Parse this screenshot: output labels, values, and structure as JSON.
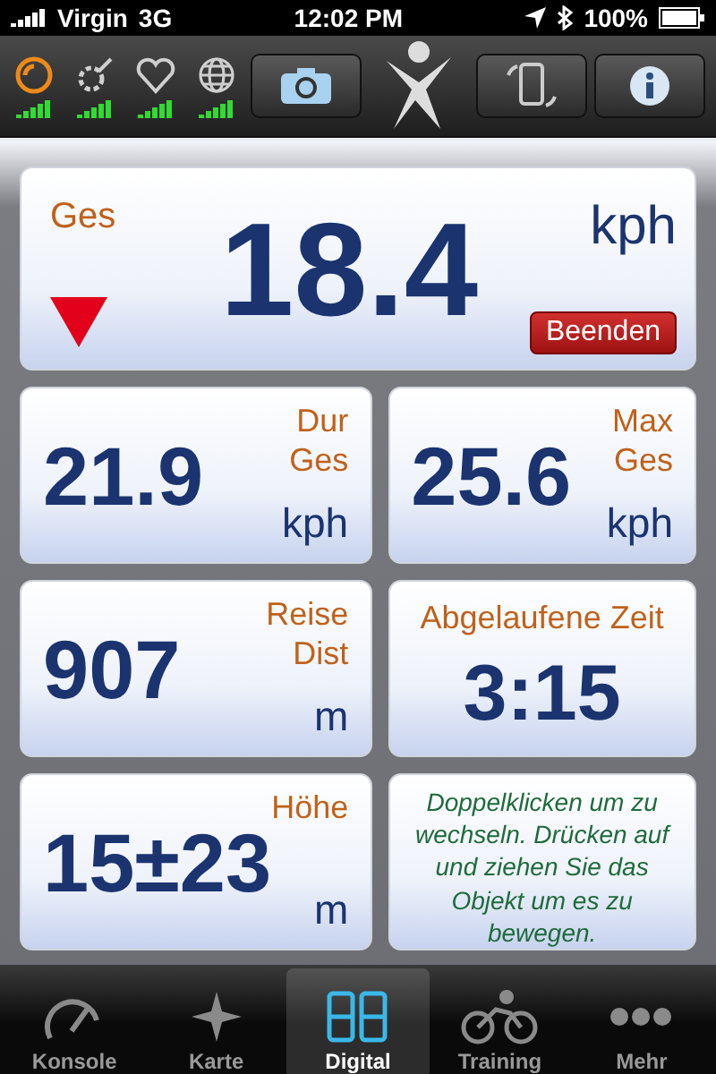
{
  "status_bar": {
    "carrier": "Virgin",
    "network": "3G",
    "time": "12:02 PM",
    "battery": "100%"
  },
  "sensors": [
    {
      "kind": "speed",
      "active": true
    },
    {
      "kind": "cadence",
      "active": false
    },
    {
      "kind": "heart",
      "active": false
    },
    {
      "kind": "gps",
      "active": false
    }
  ],
  "main": {
    "label": "Ges",
    "value": "18.4",
    "unit": "kph",
    "falling": true,
    "button": "Beenden"
  },
  "tiles": [
    {
      "kind": "stacked",
      "label": [
        "Dur",
        "Ges"
      ],
      "value": "21.9",
      "unit": "kph"
    },
    {
      "kind": "stacked",
      "label": [
        "Max",
        "Ges"
      ],
      "value": "25.6",
      "unit": "kph"
    },
    {
      "kind": "stacked",
      "label": [
        "Reise",
        "Dist"
      ],
      "value": "907",
      "unit": "m"
    },
    {
      "kind": "centered",
      "label": [
        "Abgelaufene Zeit"
      ],
      "value": "3:15"
    },
    {
      "kind": "stacked",
      "label": [
        "Höhe"
      ],
      "value": "15±23",
      "unit": "m"
    },
    {
      "kind": "note",
      "text": "Doppelklicken um zu wechseln. Drücken auf und ziehen Sie das Objekt um es zu bewegen."
    }
  ],
  "tabs": [
    {
      "label": "Konsole",
      "selected": false
    },
    {
      "label": "Karte",
      "selected": false
    },
    {
      "label": "Digital",
      "selected": true
    },
    {
      "label": "Training",
      "selected": false
    },
    {
      "label": "Mehr",
      "selected": false
    }
  ]
}
